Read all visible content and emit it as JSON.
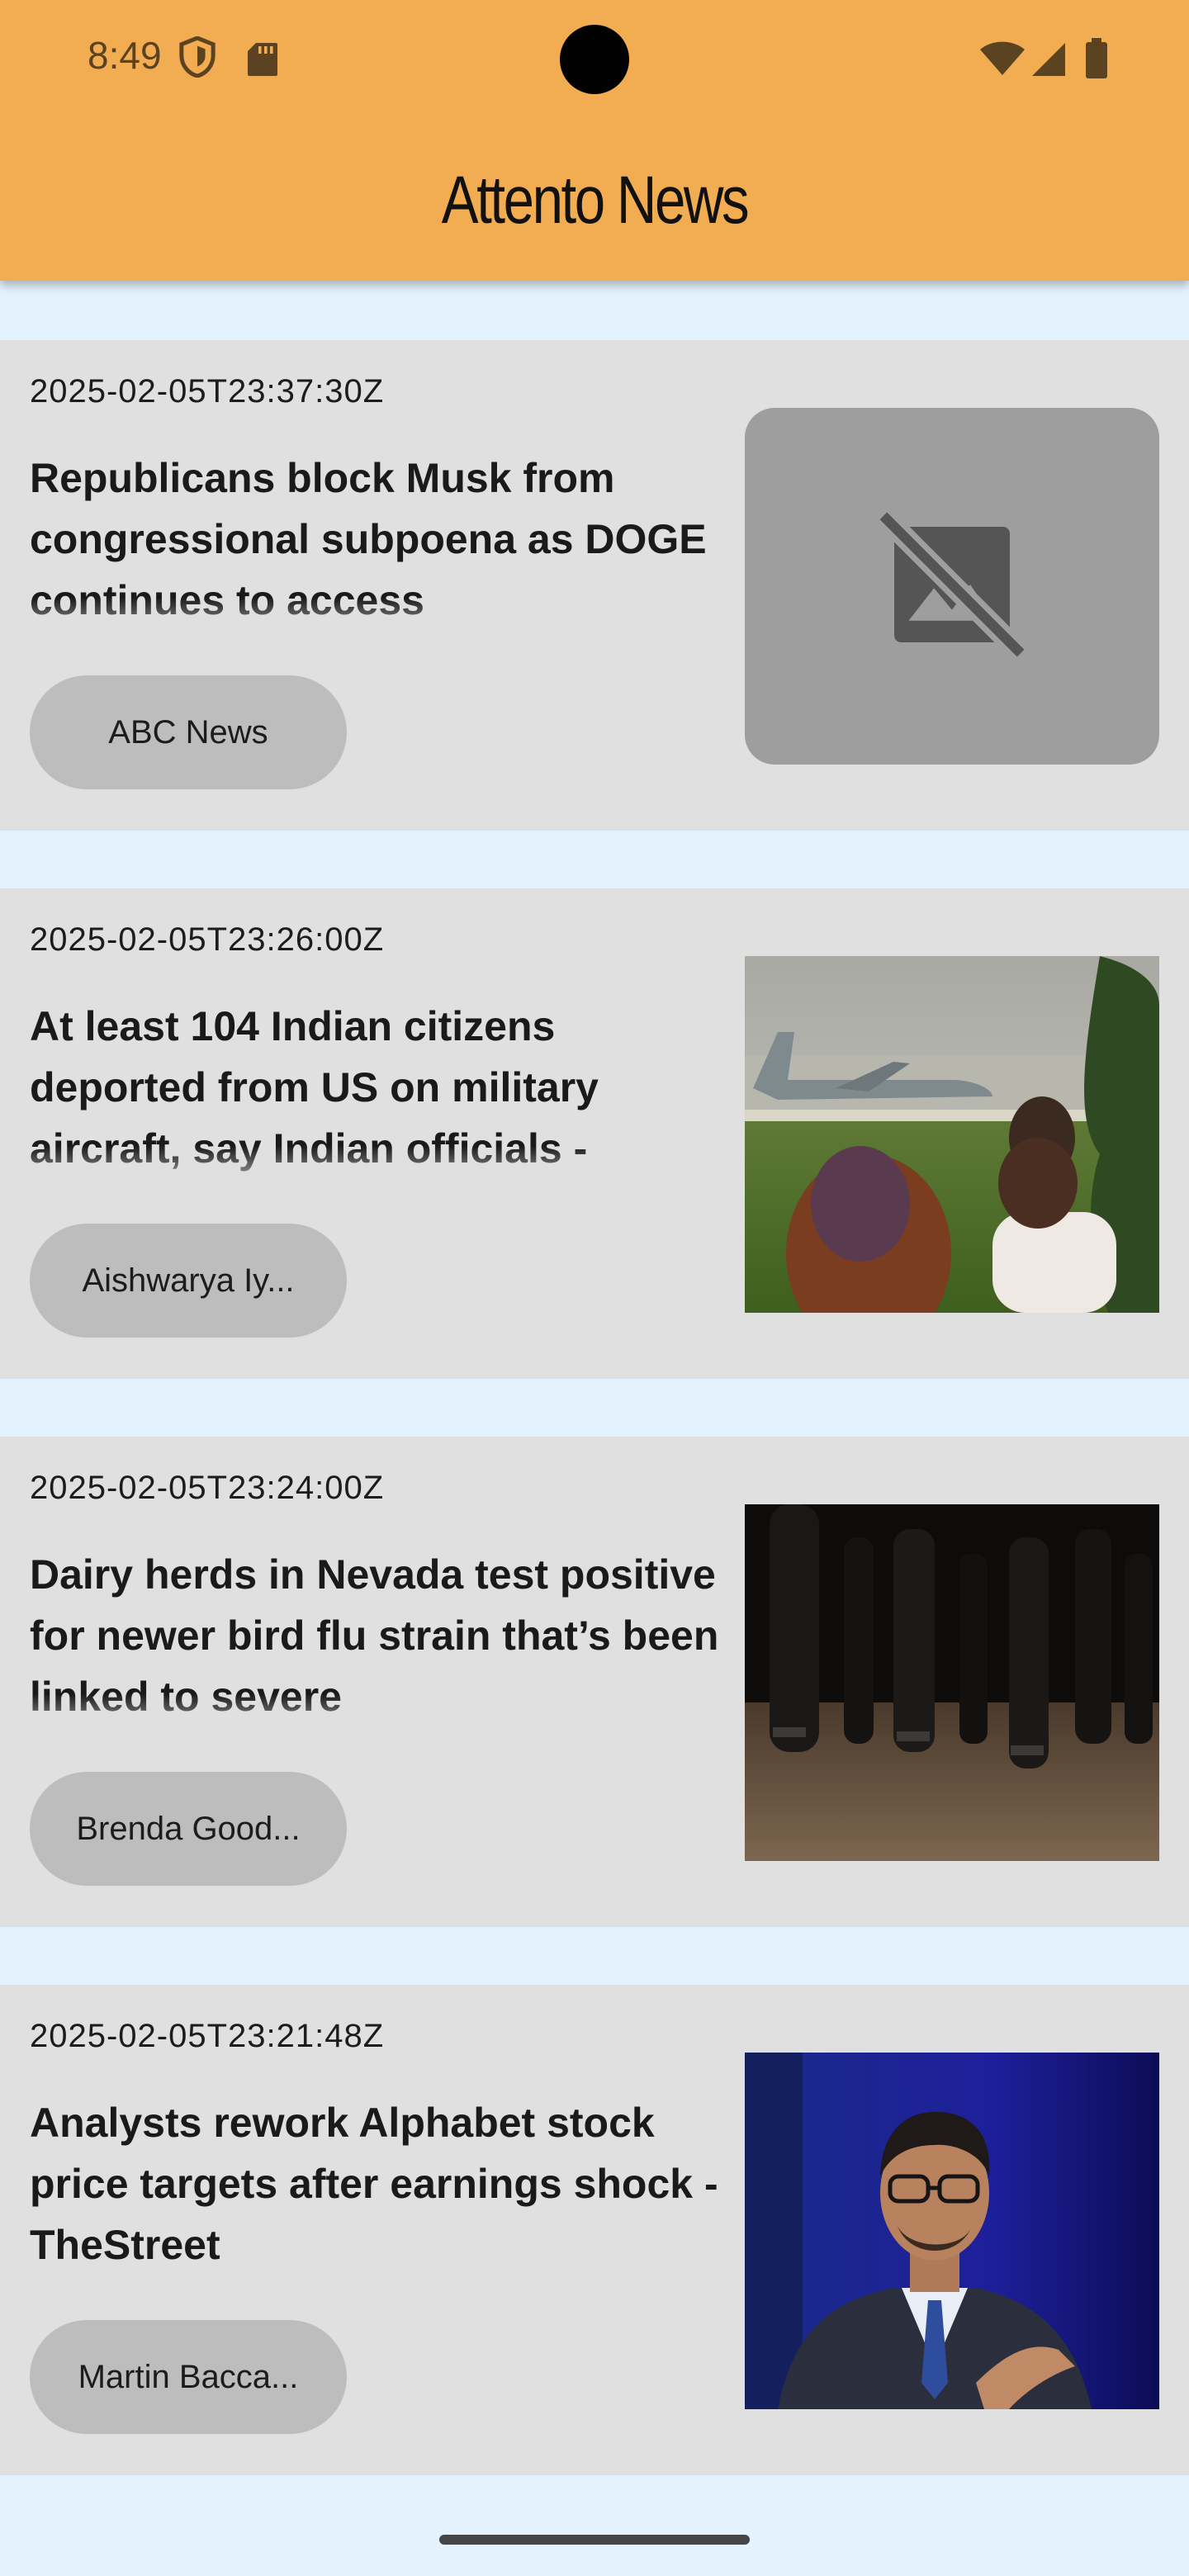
{
  "status_bar": {
    "time": "8:49",
    "icons": [
      "shield-icon",
      "sd-card-icon",
      "wifi-icon",
      "cell-signal-icon",
      "battery-icon"
    ]
  },
  "app_bar": {
    "title": "Attento News",
    "background_color": "#f2ad52"
  },
  "feed": {
    "background_color": "#e3f2fd",
    "card_color": "#e0e0e0",
    "articles": [
      {
        "published": "2025-02-05T23:37:30Z",
        "headline": "Republicans block Musk from congressional subpoena as DOGE continues to access",
        "source": "ABC News",
        "image": "image-unavailable-icon"
      },
      {
        "published": "2025-02-05T23:26:00Z",
        "headline": "At least 104 Indian citizens deported from US on military aircraft, say Indian officials -",
        "source": "Aishwarya Iy...",
        "image": "military-plane-photo"
      },
      {
        "published": "2025-02-05T23:24:00Z",
        "headline": "Dairy herds in Nevada test positive for newer bird flu strain that’s been linked to severe",
        "source": "Brenda Good...",
        "image": "dairy-cattle-photo"
      },
      {
        "published": "2025-02-05T23:21:48Z",
        "headline": "Analysts rework Alphabet stock price targets after earnings shock - TheStreet",
        "source": "Martin Bacca...",
        "image": "executive-portrait-photo"
      }
    ]
  }
}
